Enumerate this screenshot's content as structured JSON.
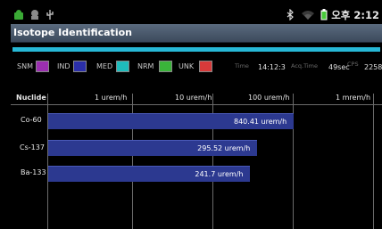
{
  "status_bar": {
    "clock": "오후 2:12",
    "icons": [
      "android-notification-icon",
      "usb-icon",
      "usb-debug-icon",
      "bluetooth-icon",
      "wifi-icon",
      "battery-icon"
    ],
    "colors": {
      "icons": "#3aaa35",
      "battery": "#48c93a"
    }
  },
  "title_bar": {
    "title": "Isotope Identification"
  },
  "progress": {
    "value": 1.0,
    "color": "#27b8d6"
  },
  "legend": {
    "items": [
      {
        "label": "SNM",
        "color": "#9b2fb0"
      },
      {
        "label": "IND",
        "color": "#2b2fa8"
      },
      {
        "label": "MED",
        "color": "#1fbcbc"
      },
      {
        "label": "NRM",
        "color": "#3ab43a"
      },
      {
        "label": "UNK",
        "color": "#d83a3a"
      }
    ]
  },
  "info": {
    "time_label": "Time",
    "time_value": "14:12:3",
    "acq_label": "Acq.Time",
    "acq_value": "49sec",
    "cps_label": "CPS",
    "cps_value": "2258"
  },
  "chart_data": {
    "type": "bar",
    "orientation": "horizontal",
    "axis_label": "Nuclide",
    "tick_labels": [
      "1 urem/h",
      "10 urem/h",
      "100 urem/h",
      "1 mrem/h"
    ],
    "scale": "log",
    "categories": [
      "Co-60",
      "Cs-137",
      "Ba-133"
    ],
    "values": [
      840.41,
      295.52,
      241.7
    ],
    "value_labels": [
      "840.41 urem/h",
      "295.52 urem/h",
      "241.7 urem/h"
    ],
    "bar_color": "#2c3990",
    "grid": true
  }
}
